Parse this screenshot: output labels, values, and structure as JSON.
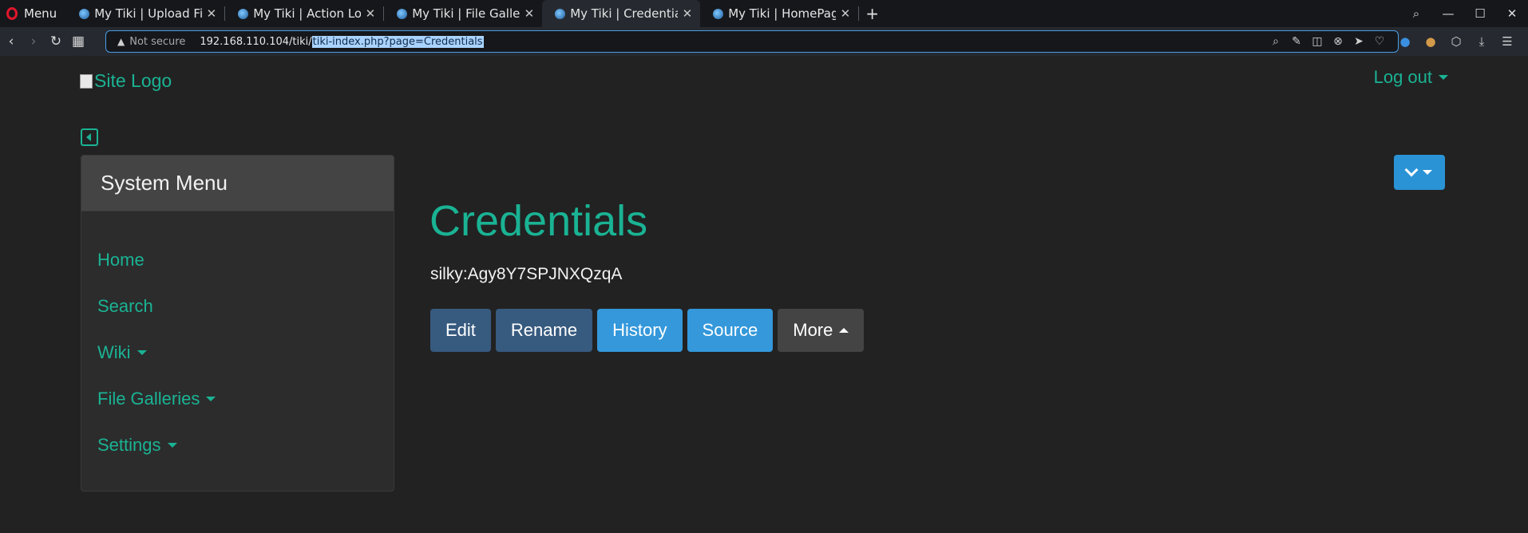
{
  "browser": {
    "menu_label": "Menu",
    "tabs": [
      {
        "title": "My Tiki | Upload File"
      },
      {
        "title": "My Tiki | Action Log"
      },
      {
        "title": "My Tiki | File Galleries"
      },
      {
        "title": "My Tiki | Credentials"
      },
      {
        "title": "My Tiki | HomePage"
      }
    ],
    "close_glyph": "✕",
    "new_tab_glyph": "+",
    "security_label": "Not secure",
    "url_host": "192.168.110.104/tiki/",
    "url_path": "tiki-index.php?page=Credentials"
  },
  "site": {
    "logo_alt": "Site Logo",
    "logout_label": "Log out",
    "sidebar_title": "System Menu",
    "menu_items": [
      {
        "label": "Home"
      },
      {
        "label": "Search"
      },
      {
        "label": "Wiki"
      },
      {
        "label": "File Galleries"
      },
      {
        "label": "Settings"
      }
    ]
  },
  "page": {
    "title": "Credentials",
    "content": "silky:Agy8Y7SPJNXQzqA",
    "buttons": {
      "edit": "Edit",
      "rename": "Rename",
      "history": "History",
      "source": "Source",
      "more": "More"
    }
  },
  "colors": {
    "accent": "#1ab394",
    "primary_button": "#375a7f",
    "info_button": "#3498db",
    "background": "#222222"
  }
}
